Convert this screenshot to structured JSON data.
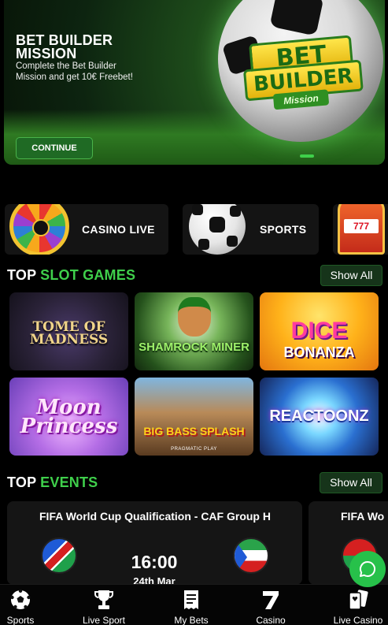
{
  "banner": {
    "title": "BET BUILDER MISSION",
    "description": "Complete the Bet Builder Mission and get 10€ Freebet!",
    "cta_label": "CONTINUE",
    "badge_line1": "BET",
    "badge_line2": "BUILDER",
    "badge_line3": "Mission"
  },
  "categories": [
    {
      "label": "CASINO LIVE",
      "icon": "wheel-icon"
    },
    {
      "label": "SPORTS",
      "icon": "soccer-ball-icon"
    },
    {
      "label": "",
      "icon": "slot-machine-icon"
    }
  ],
  "slots": {
    "title_white": "TOP",
    "title_green": "SLOT GAMES",
    "show_all": "Show All",
    "games": [
      {
        "title": "TOME OF MADNESS"
      },
      {
        "title": "SHAMROCK MINER"
      },
      {
        "title": "DICE",
        "subtitle": "BONANZA"
      },
      {
        "title": "Moon Princess"
      },
      {
        "title": "BIG BASS SPLASH",
        "subtitle": "PRAGMATIC PLAY"
      },
      {
        "title": "REACTOONZ"
      }
    ]
  },
  "events": {
    "title_white": "TOP",
    "title_green": "EVENTS",
    "show_all": "Show All",
    "items": [
      {
        "name": "FIFA World Cup Qualification - CAF Group H",
        "time": "16:00",
        "date": "24th Mar",
        "home_flag": "namibia-flag-icon",
        "away_flag": "equatorial-guinea-flag-icon"
      },
      {
        "name": "FIFA Wo",
        "away_flag": "flag-icon"
      }
    ]
  },
  "nav": {
    "items": [
      {
        "label": "Sports",
        "icon": "soccer-ball-icon"
      },
      {
        "label": "Live Sport",
        "icon": "trophy-icon"
      },
      {
        "label": "My Bets",
        "icon": "bet-slip-icon"
      },
      {
        "label": "Casino",
        "icon": "seven-icon"
      },
      {
        "label": "Live Casino",
        "icon": "cards-icon"
      }
    ]
  },
  "colors": {
    "accent": "#3fcf4b",
    "background": "#000000",
    "card": "#141414",
    "button_bg": "#16341a"
  }
}
